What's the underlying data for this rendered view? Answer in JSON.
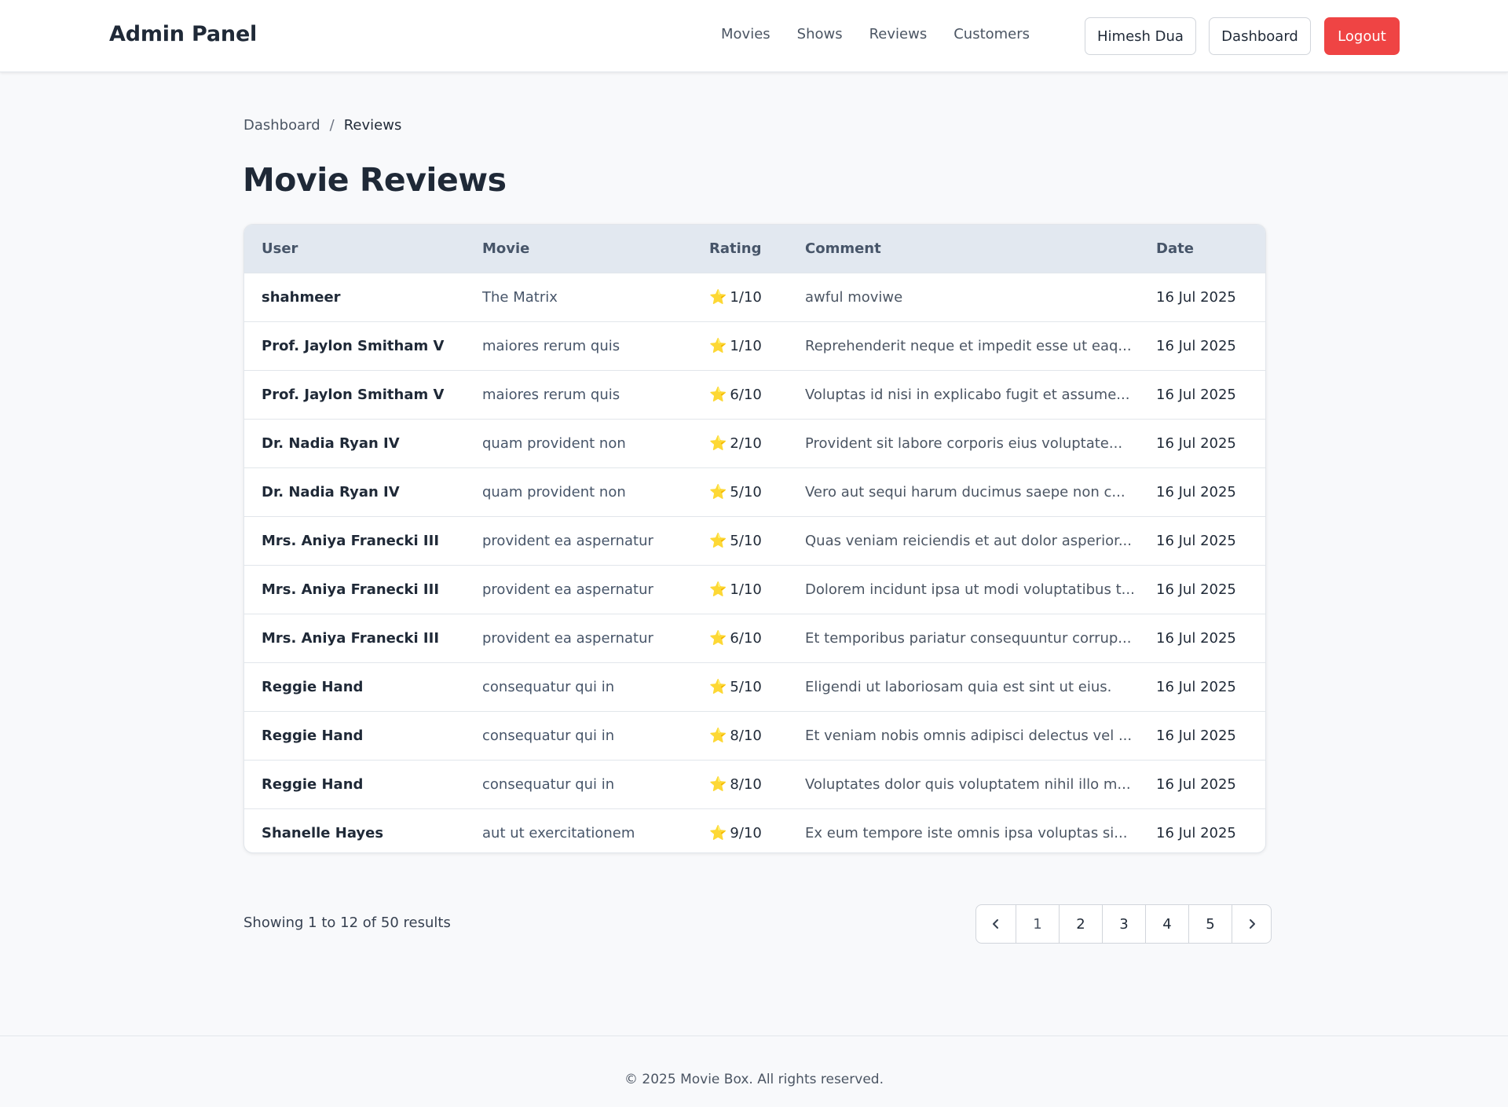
{
  "header": {
    "brand": "Admin Panel",
    "nav": [
      "Movies",
      "Shows",
      "Reviews",
      "Customers"
    ],
    "user_label": "Himesh Dua",
    "dashboard_label": "Dashboard",
    "logout_label": "Logout"
  },
  "breadcrumb": {
    "home": "Dashboard",
    "separator": "/",
    "current": "Reviews"
  },
  "page_title": "Movie Reviews",
  "table": {
    "columns": [
      "User",
      "Movie",
      "Rating",
      "Comment",
      "Date"
    ],
    "rows": [
      {
        "user": "shahmeer",
        "movie": "The Matrix",
        "rating": "1/10",
        "comment": "awful moviwe",
        "date": "16 Jul 2025"
      },
      {
        "user": "Prof. Jaylon Smitham V",
        "movie": "maiores rerum quis",
        "rating": "1/10",
        "comment": "Reprehenderit neque et impedit esse ut eaq...",
        "date": "16 Jul 2025"
      },
      {
        "user": "Prof. Jaylon Smitham V",
        "movie": "maiores rerum quis",
        "rating": "6/10",
        "comment": "Voluptas id nisi in explicabo fugit et assume...",
        "date": "16 Jul 2025"
      },
      {
        "user": "Dr. Nadia Ryan IV",
        "movie": "quam provident non",
        "rating": "2/10",
        "comment": "Provident sit labore corporis eius voluptate...",
        "date": "16 Jul 2025"
      },
      {
        "user": "Dr. Nadia Ryan IV",
        "movie": "quam provident non",
        "rating": "5/10",
        "comment": "Vero aut sequi harum ducimus saepe non c...",
        "date": "16 Jul 2025"
      },
      {
        "user": "Mrs. Aniya Franecki III",
        "movie": "provident ea aspernatur",
        "rating": "5/10",
        "comment": "Quas veniam reiciendis et aut dolor asperior...",
        "date": "16 Jul 2025"
      },
      {
        "user": "Mrs. Aniya Franecki III",
        "movie": "provident ea aspernatur",
        "rating": "1/10",
        "comment": "Dolorem incidunt ipsa ut modi voluptatibus t...",
        "date": "16 Jul 2025"
      },
      {
        "user": "Mrs. Aniya Franecki III",
        "movie": "provident ea aspernatur",
        "rating": "6/10",
        "comment": "Et temporibus pariatur consequuntur corrup...",
        "date": "16 Jul 2025"
      },
      {
        "user": "Reggie Hand",
        "movie": "consequatur qui in",
        "rating": "5/10",
        "comment": "Eligendi ut laboriosam quia est sint ut eius.",
        "date": "16 Jul 2025"
      },
      {
        "user": "Reggie Hand",
        "movie": "consequatur qui in",
        "rating": "8/10",
        "comment": "Et veniam nobis omnis adipisci delectus vel ...",
        "date": "16 Jul 2025"
      },
      {
        "user": "Reggie Hand",
        "movie": "consequatur qui in",
        "rating": "8/10",
        "comment": "Voluptates dolor quis voluptatem nihil illo m...",
        "date": "16 Jul 2025"
      },
      {
        "user": "Shanelle Hayes",
        "movie": "aut ut exercitationem",
        "rating": "9/10",
        "comment": "Ex eum tempore iste omnis ipsa voluptas si...",
        "date": "16 Jul 2025"
      }
    ],
    "rating_icon": "star-icon",
    "rating_icon_glyph": "⭐"
  },
  "results": {
    "prefix": "Showing",
    "from": "1",
    "to_word": "to",
    "to": "12",
    "of_word": "of",
    "total": "50",
    "suffix": "results"
  },
  "pagination": {
    "pages": [
      "1",
      "2",
      "3",
      "4",
      "5"
    ],
    "current": "1",
    "prev_icon": "chevron-left-icon",
    "next_icon": "chevron-right-icon"
  },
  "footer": {
    "text": "© 2025 Movie Box. All rights reserved."
  },
  "colors": {
    "logout": "#ef4444",
    "table_header_bg": "#e2e8f0",
    "page_bg": "#f8f9fb",
    "star": "#f5b301"
  }
}
